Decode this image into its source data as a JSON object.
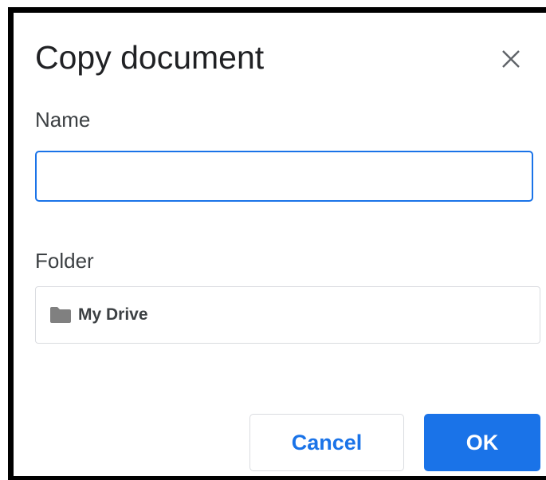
{
  "dialog": {
    "title": "Copy document",
    "close_icon": "close-icon"
  },
  "name_field": {
    "label": "Name",
    "value": "",
    "placeholder": ""
  },
  "folder_field": {
    "label": "Folder",
    "icon": "folder-icon",
    "value": "My Drive"
  },
  "buttons": {
    "cancel_label": "Cancel",
    "ok_label": "OK"
  },
  "colors": {
    "accent": "#1a73e8",
    "border": "#dadce0",
    "text": "#202124"
  }
}
